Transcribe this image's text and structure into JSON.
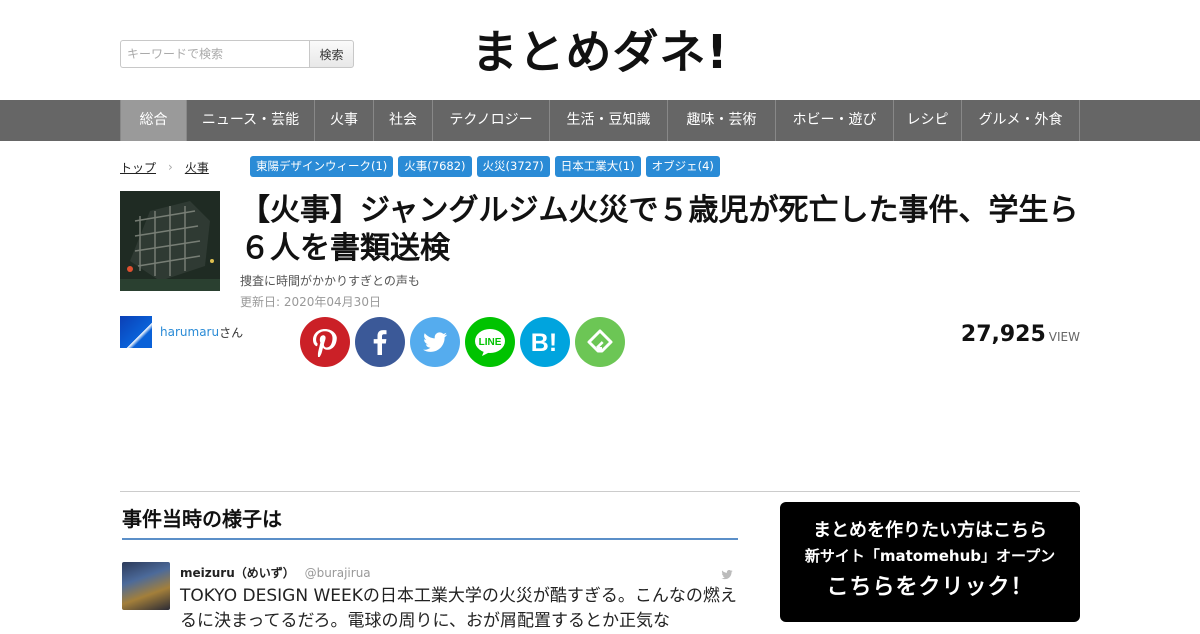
{
  "header": {
    "search": {
      "placeholder": "キーワードで検索",
      "button_label": "検索"
    },
    "logo": "まとめダネ!"
  },
  "nav": {
    "items": [
      {
        "label": "総合",
        "active": true
      },
      {
        "label": "ニュース・芸能"
      },
      {
        "label": "火事"
      },
      {
        "label": "社会"
      },
      {
        "label": "テクノロジー"
      },
      {
        "label": "生活・豆知識"
      },
      {
        "label": "趣味・芸術"
      },
      {
        "label": "ホビー・遊び"
      },
      {
        "label": "レシピ"
      },
      {
        "label": "グルメ・外食"
      }
    ]
  },
  "breadcrumb": {
    "home": "トップ",
    "current": "火事"
  },
  "tags": [
    "東陽デザインウィーク(1)",
    "火事(7682)",
    "火災(3727)",
    "日本工業大(1)",
    "オブジェ(4)"
  ],
  "article": {
    "title": "【火事】ジャングルジム火災で５歳児が死亡した事件、学生ら６人を書類送検",
    "subtitle": "捜査に時間がかかりすぎとの声も",
    "updated_label": "更新日:",
    "updated_date": "2020年04月30日",
    "author": {
      "name": "harumaru",
      "suffix": "さん"
    },
    "views": {
      "count": "27,925",
      "label": "VIEW"
    }
  },
  "share": {
    "buttons": [
      {
        "name": "pinterest",
        "color": "#cb2027"
      },
      {
        "name": "facebook",
        "color": "#3b5998"
      },
      {
        "name": "twitter",
        "color": "#55acee"
      },
      {
        "name": "line",
        "color": "#00c300"
      },
      {
        "name": "hatena",
        "color": "#00a4de"
      },
      {
        "name": "feedly",
        "color": "#6cc655"
      }
    ]
  },
  "section": {
    "title": "事件当時の様子は"
  },
  "tweet": {
    "name": "meizuru（めいず）",
    "handle": "@burajirua",
    "text": "TOKYO DESIGN WEEKの日本工業大学の火災が酷すぎる。こんなの燃えるに決まってるだろ。電球の周りに、おが屑配置するとか正気な"
  },
  "cta": {
    "line1": "まとめを作りたい方はこちら",
    "line2": "新サイト「matomehub」オープン",
    "line3": "こちらをクリック！"
  }
}
